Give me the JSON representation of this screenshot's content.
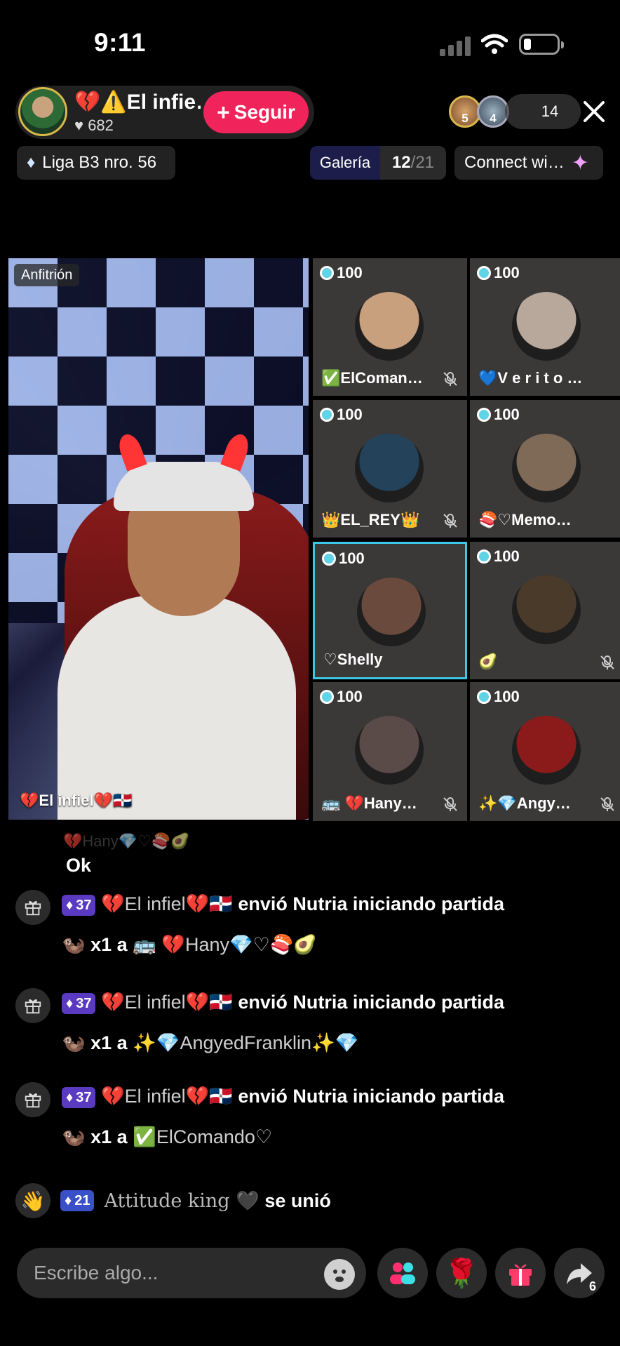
{
  "status_bar": {
    "time": "9:11"
  },
  "header": {
    "host_name": "💔⚠️El infie…",
    "host_likes": "682",
    "follow_label": "Seguir",
    "viewer_badges": [
      "5",
      "4"
    ],
    "viewer_count": "14",
    "league": "Liga B3 nro. 56",
    "gallery_label": "Galería",
    "gallery_count": "12",
    "gallery_total": "/21",
    "connect_label": "Connect wi…"
  },
  "host_video": {
    "tag": "Anfitrión",
    "name": "💔El infiel💔🇩🇴"
  },
  "guests": [
    {
      "score": "100",
      "name": "✅ElComan…",
      "muted": true,
      "avatar_color": "#c9a07e"
    },
    {
      "score": "100",
      "name": "💙V e r i t o D L e…",
      "muted": false,
      "avatar_color": "#b8a89c"
    },
    {
      "score": "100",
      "name": "👑EL_REY👑",
      "muted": true,
      "avatar_color": "#24425a"
    },
    {
      "score": "100",
      "name": "🍣♡Memo…",
      "muted": false,
      "avatar_color": "#7f6a58"
    },
    {
      "score": "100",
      "name": "♡Shelly",
      "muted": false,
      "active": true,
      "avatar_color": "#6b4a3e"
    },
    {
      "score": "100",
      "name": "🥑",
      "muted": true,
      "avatar_color": "#4a3a2a"
    },
    {
      "score": "100",
      "name": "🚌 💔Hany…",
      "muted": true,
      "avatar_color": "#5a4a48"
    },
    {
      "score": "100",
      "name": "✨💎Angy…",
      "muted": true,
      "avatar_color": "#8b1a1a"
    }
  ],
  "chat": {
    "faded": "💔Hany💎♡🍣🥑",
    "ok": "Ok",
    "gift_messages": [
      {
        "level": "37",
        "sender": "💔El infiel💔🇩🇴",
        "action": "envió Nutria iniciando partida",
        "qty": "x1 a",
        "recipient": "🚌 💔Hany💎♡🍣🥑"
      },
      {
        "level": "37",
        "sender": "💔El infiel💔🇩🇴",
        "action": "envió Nutria iniciando partida",
        "qty": "x1 a",
        "recipient": "✨💎AngyedFranklin✨💎"
      },
      {
        "level": "37",
        "sender": "💔El infiel💔🇩🇴",
        "action": "envió Nutria iniciando partida",
        "qty": "x1 a",
        "recipient": "✅ElComando♡"
      }
    ],
    "join": {
      "level": "21",
      "user": "Attitude king 🖤",
      "action": "se unió"
    }
  },
  "bottom": {
    "placeholder": "Escribe algo...",
    "share_count": "6"
  },
  "colors": {
    "follow": "#f0245a",
    "badge": "#5a3ac0",
    "active_tile": "#3ec6e6"
  }
}
